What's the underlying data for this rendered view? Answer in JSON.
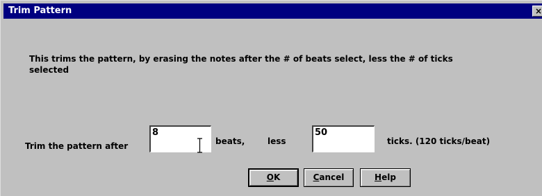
{
  "window": {
    "title": "Trim Pattern",
    "close_glyph": "×"
  },
  "description": "This trims the pattern, by erasing the notes after the # of beats select, less the # of ticks selected",
  "form": {
    "trim_label": "Trim the pattern after",
    "beats_value": "8",
    "beats_unit": "beats,",
    "less_label": "less",
    "ticks_value": "50",
    "ticks_unit": "ticks. (120 ticks/beat)"
  },
  "buttons": {
    "ok_mnemonic": "O",
    "ok_rest": "K",
    "cancel_mnemonic": "C",
    "cancel_rest": "ancel",
    "help_mnemonic": "H",
    "help_rest": "elp"
  },
  "icons": {
    "cursor": "text-cursor-icon"
  }
}
